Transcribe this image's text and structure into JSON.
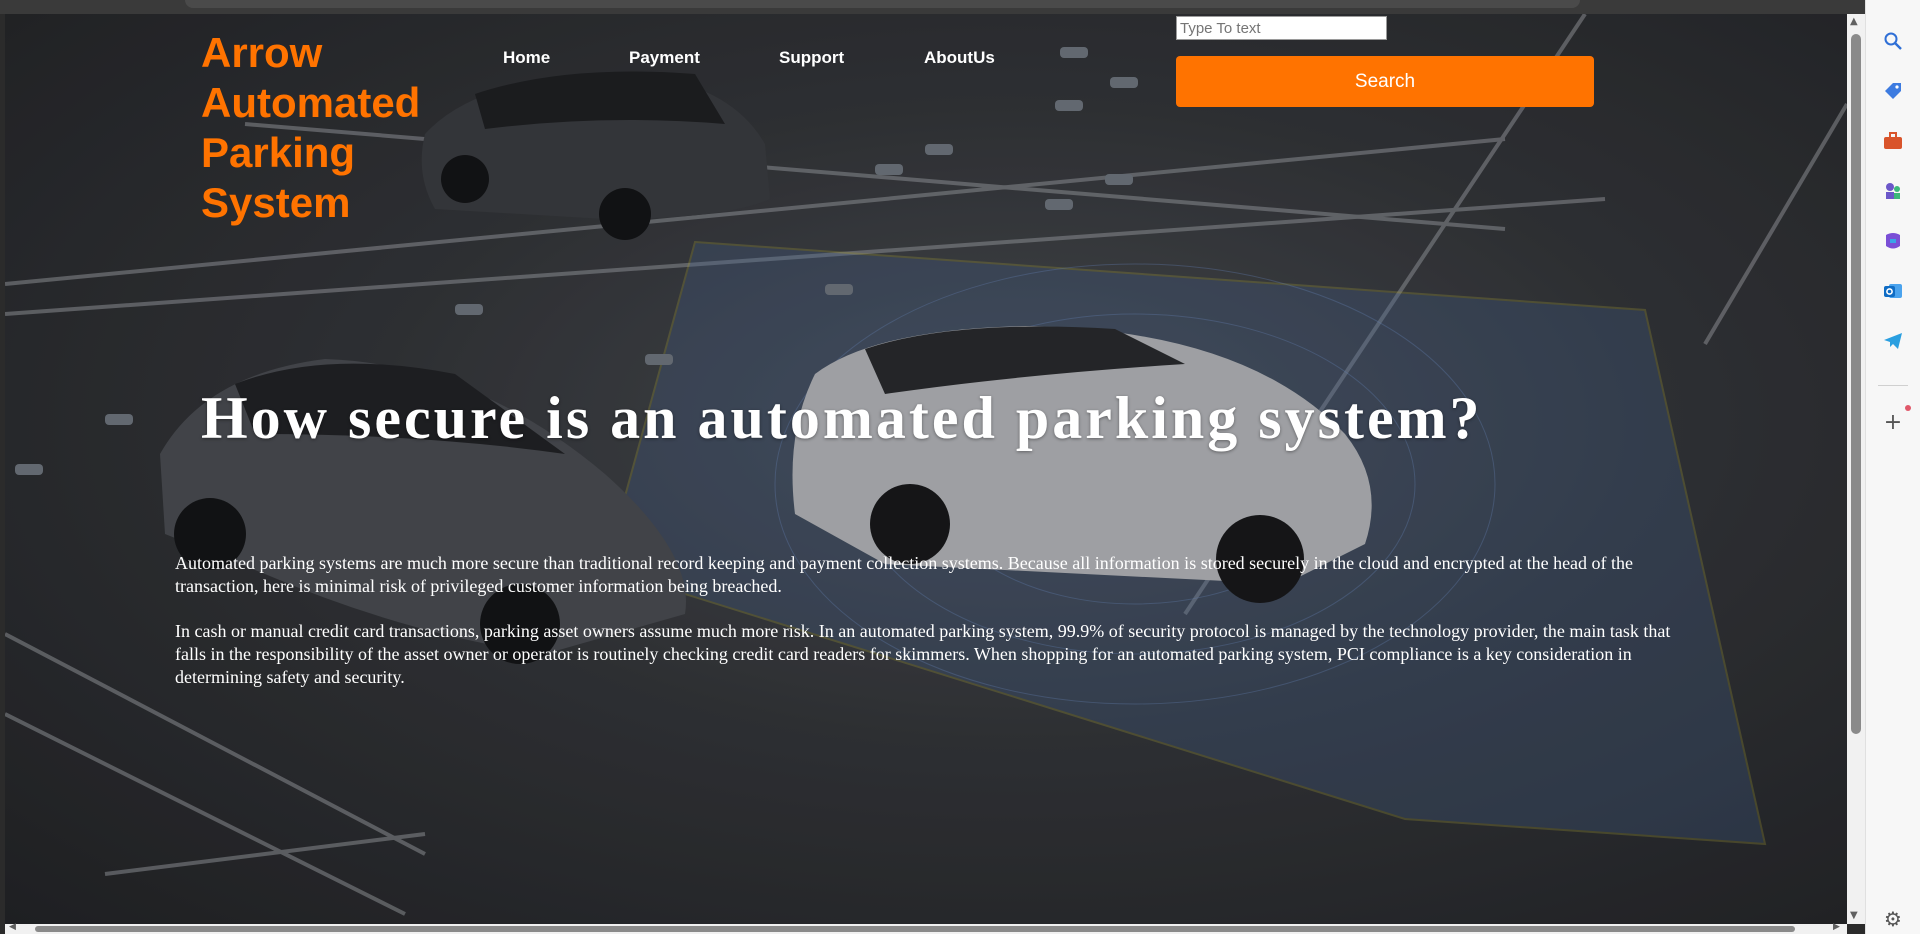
{
  "site": {
    "logo_lines": [
      "Arrow",
      "Automated",
      "Parking",
      "System"
    ],
    "nav": [
      {
        "label": "Home"
      },
      {
        "label": "Payment"
      },
      {
        "label": "Support"
      },
      {
        "label": "AboutUs"
      }
    ],
    "search": {
      "placeholder": "Type To text",
      "button_label": "Search"
    },
    "headline": "How secure is an automated parking system?",
    "paragraphs": [
      "Automated parking systems are much more secure than traditional record keeping and payment collection systems. Because all information is stored securely in the cloud and encrypted at the head of the transaction, here is minimal risk of privileged customer information being breached.",
      "In cash or manual credit card transactions, parking asset owners assume much more risk. In an automated parking system, 99.9% of security protocol is managed by the technology provider, the main task that falls in the responsibility of the asset owner or operator is routinely checking credit card readers for skimmers. When shopping for an automated parking system, PCI compliance is a key consideration in determining safety and security."
    ],
    "colors": {
      "accent": "#ff7300",
      "text": "#ffffff"
    }
  },
  "browser_sidebar": {
    "icons": [
      "search-icon",
      "tag-icon",
      "toolbox-icon",
      "chess-icon",
      "copilot-icon",
      "outlook-icon",
      "telegram-icon",
      "add-icon",
      "settings-icon"
    ]
  }
}
